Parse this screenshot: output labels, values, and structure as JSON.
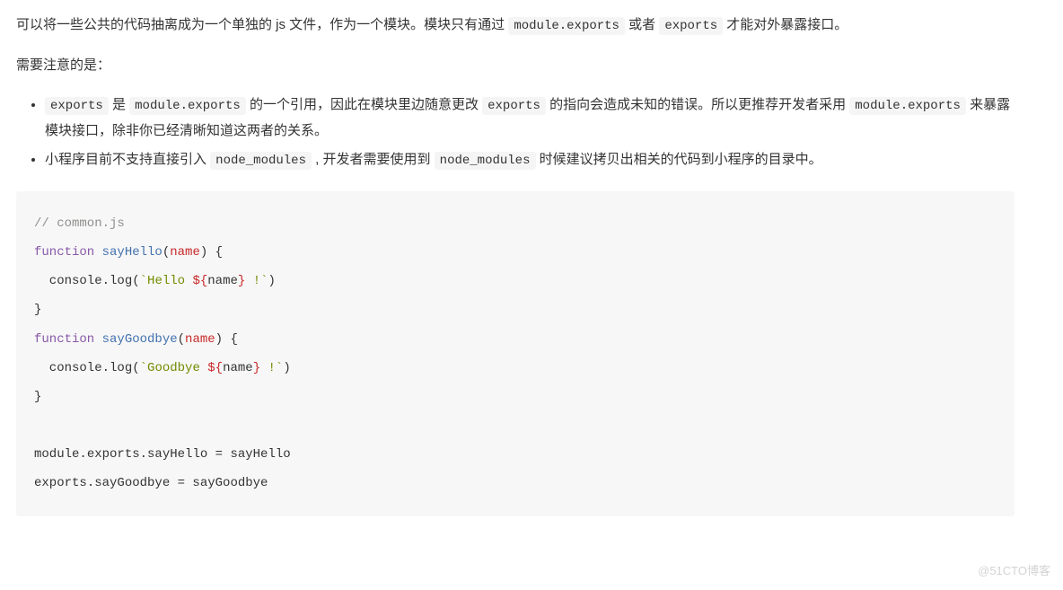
{
  "intro": {
    "seg1": "可以将一些公共的代码抽离成为一个单独的 js 文件，作为一个模块。模块只有通过 ",
    "code1": "module.exports",
    "seg2": " 或者 ",
    "code2": "exports",
    "seg3": " 才能对外暴露接口。"
  },
  "note_heading": "需要注意的是：",
  "bullets": {
    "b1": {
      "code1": "exports",
      "seg1": " 是 ",
      "code2": "module.exports",
      "seg2": " 的一个引用，因此在模块里边随意更改 ",
      "code3": "exports",
      "seg3": " 的指向会造成未知的错误。所以更推荐开发者采用 ",
      "code4": "module.exports",
      "seg4": " 来暴露模块接口，除非你已经清晰知道这两者的关系。"
    },
    "b2": {
      "seg1": "小程序目前不支持直接引入 ",
      "code1": "node_modules",
      "seg2": " , 开发者需要使用到 ",
      "code2": "node_modules",
      "seg3": " 时候建议拷贝出相关的代码到小程序的目录中。"
    }
  },
  "code": {
    "l1_comment": "// common.js",
    "l2_kw": "function",
    "l2_name": " sayHello",
    "l2_p_open": "(",
    "l2_param": "name",
    "l2_p_close": ") {",
    "l3_indent": "  console",
    "l3_dot_log": ".log(",
    "l3_tick_open": "`",
    "l3_str1": "Hello ",
    "l3_tpl_open": "${",
    "l3_tpl_var": "name",
    "l3_tpl_close": "}",
    "l3_str2": " !",
    "l3_tick_close": "`",
    "l3_close": ")",
    "l4_brace": "}",
    "l5_kw": "function",
    "l5_name": " sayGoodbye",
    "l5_p_open": "(",
    "l5_param": "name",
    "l5_p_close": ") {",
    "l6_indent": "  console",
    "l6_dot_log": ".log(",
    "l6_tick_open": "`",
    "l6_str1": "Goodbye ",
    "l6_tpl_open": "${",
    "l6_tpl_var": "name",
    "l6_tpl_close": "}",
    "l6_str2": " !",
    "l6_tick_close": "`",
    "l6_close": ")",
    "l7_brace": "}",
    "l8_module": "module",
    "l8_rest": ".exports.sayHello = sayHello",
    "l9_exports": "exports",
    "l9_rest": ".sayGoodbye = sayGoodbye"
  },
  "watermark": "@51CTO博客"
}
